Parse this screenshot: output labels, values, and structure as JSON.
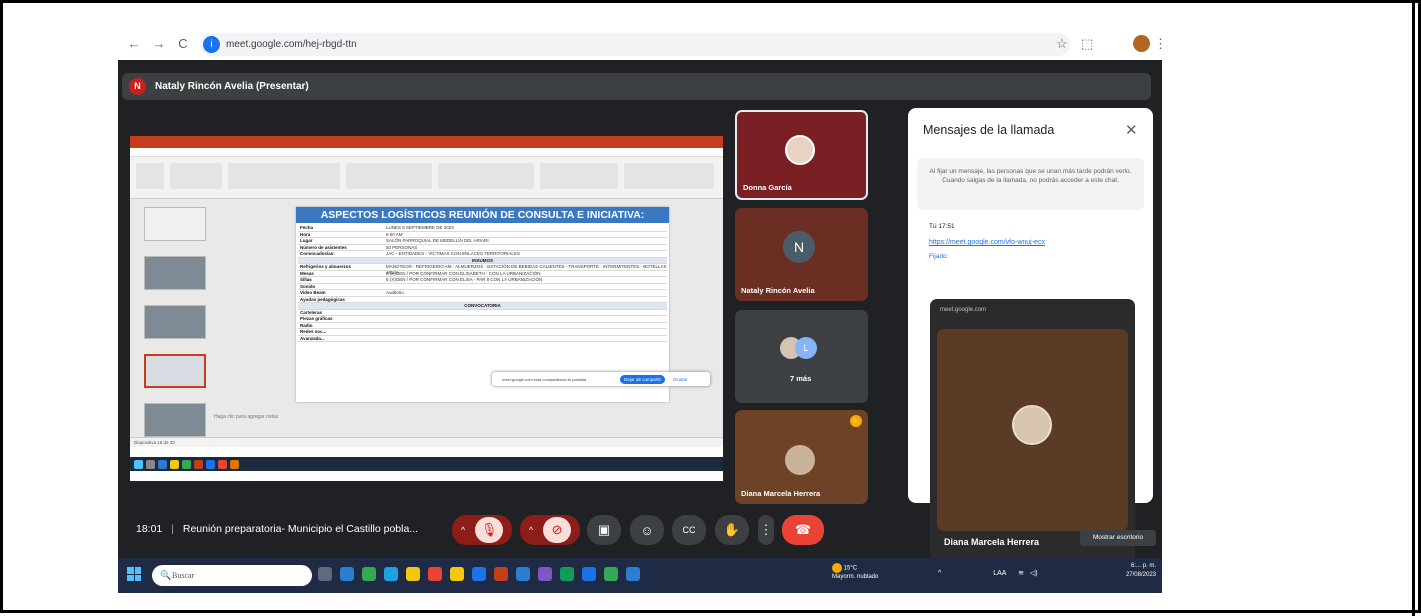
{
  "browser": {
    "url": "meet.google.com/hej-rbgd-ttn",
    "back_icon": "←",
    "forward_icon": "→",
    "reload_icon": "C",
    "star_icon": "☆",
    "extension_icon": "⬚",
    "menu_icon": "⋮"
  },
  "presenter": {
    "badge": "N",
    "label": "Nataly Rincón Avelia (Presentar)"
  },
  "presentation": {
    "slide_title": "ASPECTOS LOGÍSTICOS REUNIÓN DE CONSULTA E INICIATIVA:",
    "rows": [
      {
        "k": "Fecha",
        "v": "LUNES 8 SEPTIEMBRE DE 2023"
      },
      {
        "k": "Hora",
        "v": "9:00 AM"
      },
      {
        "k": "Lugar",
        "v": "SALÓN PARROQUIAL DE MEDELLÍN DEL ARIARI"
      },
      {
        "k": "Número de asistentes",
        "v": "50 PERSONAS"
      },
      {
        "k": "Convocados/as:",
        "v": "JAC - ENTIDADES - VÍCTIMAS CON ENLACES TERRITORIALES"
      },
      {
        "k": "",
        "v": "INSUMOS",
        "header": true
      },
      {
        "k": "Refrigerios y almuerzos",
        "v": "MANOTEOS · REFRIGERIO AM · ALMUERZOS · ESTACIÓN DE BEBIDAS CALIENTES · TRANSPORTE · INTERMITENTES · BOTELLAS AGUA"
      },
      {
        "k": "Mesas",
        "v": "6 (X)GEN / POR CONFIRMAR CON ELISABETH - CON LA URBANIZACIÓN"
      },
      {
        "k": "Sillas",
        "v": "6 (X)GEN / POR CONFIRMAR CON ELISA - PAR 8 CON LA URBANIZACIÓN"
      },
      {
        "k": "Sonido",
        "v": ""
      },
      {
        "k": "Video Beam",
        "v": "Auditorio"
      },
      {
        "k": "Ayudas pedagógicas",
        "v": ""
      },
      {
        "k": "",
        "v": "CONVOCATORIA",
        "header": true
      },
      {
        "k": "Carteleras",
        "v": ""
      },
      {
        "k": "Piezas gráficas",
        "v": ""
      },
      {
        "k": "Radio",
        "v": ""
      },
      {
        "k": "Redes soc...",
        "v": ""
      },
      {
        "k": "Avanzada...",
        "v": ""
      }
    ],
    "share_notice": "meet.google.com está compartiendo tu pantalla",
    "stop_share": "Dejar de compartir",
    "hide": "Ocultar",
    "notes_hint": "Haga clic para agregar notas",
    "status": "Diapositiva 18 de 33"
  },
  "participants": [
    {
      "name": "Donna García"
    },
    {
      "name": "Nataly Rincón Avelia",
      "initial": "N"
    },
    {
      "name": "7 más",
      "initial": "L"
    },
    {
      "name": "Diana Marcela Herrera"
    }
  ],
  "chat": {
    "title": "Mensajes de la llamada",
    "close_icon": "✕",
    "info": "Al fijar un mensaje, las personas que se unan más tarde podrán verlo. Cuando salgas de la llamada, no podrás acceder a este chat.",
    "message_meta": "Tú 17:51",
    "message_link": "https://meet.google.com/vfo-wnuj-ecx",
    "pin": "Fijado"
  },
  "pip": {
    "site": "meet.google.com",
    "name": "Diana Marcela Herrera",
    "tooltip": "Mostrar escritorio"
  },
  "meeting": {
    "time": "18:01",
    "title": "Reunión preparatoria- Municipio el Castillo pobla..."
  },
  "taskbar": {
    "search": "Buscar",
    "temp": "15°C",
    "weather": "Mayorm. nublado",
    "lang": "LAA",
    "time": "6:... p. m.",
    "date": "27/08/2023"
  },
  "colors": {
    "meet_bg": "#202124",
    "accent_blue": "#1a73e8",
    "end_call": "#ea4335",
    "ppt_orange": "#c43e1c",
    "slide_title": "#3b78c2"
  }
}
